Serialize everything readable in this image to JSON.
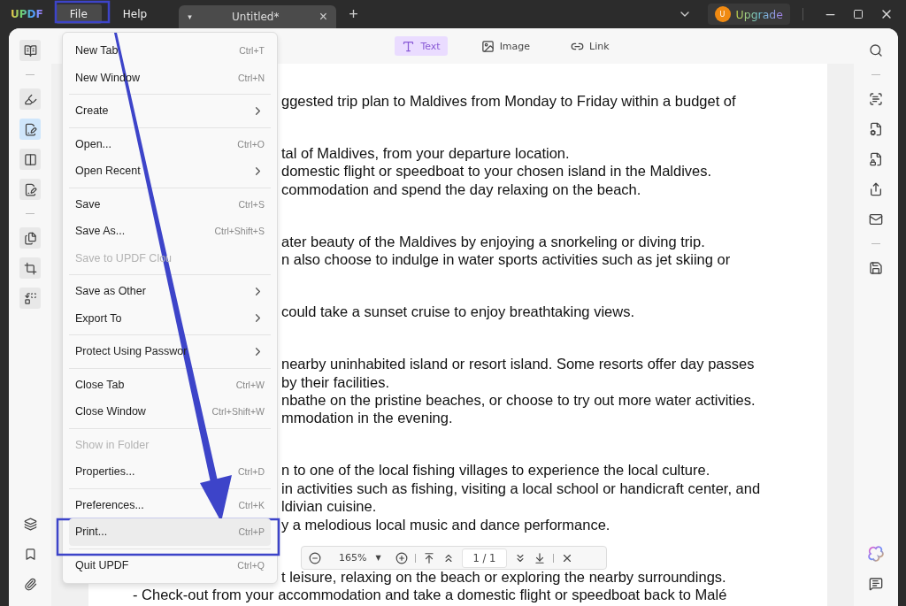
{
  "title_bar": {
    "logo": "UPDF",
    "menus": [
      {
        "label": "File",
        "selected": true
      },
      {
        "label": "Help",
        "selected": false
      }
    ],
    "tab": {
      "caret": "▾",
      "title": "Untitled*",
      "close": "×"
    },
    "new_tab": "+",
    "upgrade": {
      "avatar_initial": "U",
      "label": "Upgrade"
    }
  },
  "left_rail": [
    {
      "kind": "reader",
      "selected": false
    },
    {
      "kind": "divider"
    },
    {
      "kind": "comment",
      "selected": false
    },
    {
      "kind": "edit",
      "selected": true
    },
    {
      "kind": "organize",
      "selected": false
    },
    {
      "kind": "fill-sign",
      "selected": false
    },
    {
      "kind": "divider"
    },
    {
      "kind": "pages",
      "selected": false
    },
    {
      "kind": "crop",
      "selected": false
    },
    {
      "kind": "replace",
      "selected": false
    }
  ],
  "left_rail_bottom": [
    {
      "kind": "layers"
    },
    {
      "kind": "bookmark"
    },
    {
      "kind": "attachment"
    }
  ],
  "edit_toolbar": [
    {
      "kind": "text",
      "label": "Text",
      "selected": true
    },
    {
      "kind": "image",
      "label": "Image",
      "selected": false
    },
    {
      "kind": "link",
      "label": "Link",
      "selected": false
    }
  ],
  "document": {
    "paragraphs": [
      {
        "lines": [
          "ggested trip plan to Maldives from Monday to Friday within a budget of"
        ]
      },
      {
        "lines": [
          "tal of Maldives, from your departure location.",
          "domestic flight or speedboat to your chosen island in the Maldives.",
          "commodation and spend the day relaxing on the beach."
        ]
      },
      {
        "lines": [
          "ater beauty of the Maldives by enjoying a snorkeling or diving trip.",
          "n also choose to indulge in water sports activities such as jet skiing or"
        ]
      },
      {
        "lines": [
          "could take a sunset cruise to enjoy breathtaking views."
        ]
      },
      {
        "lines": [
          "nearby uninhabited island or resort island. Some resorts offer day passes",
          "by their facilities.",
          "nbathe on the pristine beaches, or choose to try out more water activities.",
          "mmodation in the evening."
        ]
      },
      {
        "lines": [
          "n to one of the local fishing villages to experience the local culture.",
          "in activities such as fishing, visiting a local school or handicraft center, and",
          "ldivian cuisine.",
          "y a melodious local music and dance performance."
        ]
      },
      {
        "lines": [
          "t leisure, relaxing on the beach or exploring the nearby surroundings."
        ]
      }
    ],
    "bottom_line": "- Check-out from your accommodation and take a domestic flight or speedboat back to Malé"
  },
  "right_rail": [
    {
      "kind": "search"
    },
    {
      "kind": "divider"
    },
    {
      "kind": "ocr"
    },
    {
      "kind": "convert"
    },
    {
      "kind": "protect"
    },
    {
      "kind": "share"
    },
    {
      "kind": "mail"
    },
    {
      "kind": "divider"
    },
    {
      "kind": "save"
    }
  ],
  "right_rail_bottom": [
    {
      "kind": "ai"
    },
    {
      "kind": "comments"
    }
  ],
  "file_menu": {
    "groups": [
      [
        {
          "label": "New Tab",
          "shortcut": "Ctrl+T",
          "kind": "item",
          "disabled": false,
          "selected": false
        },
        {
          "label": "New Window",
          "shortcut": "Ctrl+N",
          "kind": "item",
          "disabled": false,
          "selected": false
        }
      ],
      [
        {
          "label": "Create",
          "kind": "submenu",
          "disabled": false,
          "selected": false
        }
      ],
      [
        {
          "label": "Open...",
          "shortcut": "Ctrl+O",
          "kind": "item",
          "disabled": false,
          "selected": false
        },
        {
          "label": "Open Recent",
          "kind": "submenu",
          "disabled": false,
          "selected": false
        }
      ],
      [
        {
          "label": "Save",
          "shortcut": "Ctrl+S",
          "kind": "item",
          "disabled": false,
          "selected": false
        },
        {
          "label": "Save As...",
          "shortcut": "Ctrl+Shift+S",
          "kind": "item",
          "disabled": false,
          "selected": false
        },
        {
          "label": "Save to UPDF Clou",
          "kind": "item",
          "disabled": true,
          "selected": false
        }
      ],
      [
        {
          "label": "Save as Other",
          "kind": "submenu",
          "disabled": false,
          "selected": false
        },
        {
          "label": "Export To",
          "kind": "submenu",
          "disabled": false,
          "selected": false
        }
      ],
      [
        {
          "label": "Protect Using Passwor",
          "kind": "submenu",
          "disabled": false,
          "selected": false
        }
      ],
      [
        {
          "label": "Close Tab",
          "shortcut": "Ctrl+W",
          "kind": "item",
          "disabled": false,
          "selected": false
        },
        {
          "label": "Close Window",
          "shortcut": "Ctrl+Shift+W",
          "kind": "item",
          "disabled": false,
          "selected": false
        }
      ],
      [
        {
          "label": "Show in Folder",
          "kind": "item",
          "disabled": true,
          "selected": false
        },
        {
          "label": "Properties...",
          "shortcut": "Ctrl+D",
          "kind": "item",
          "disabled": false,
          "selected": false
        }
      ],
      [
        {
          "label": "Preferences...",
          "shortcut": "Ctrl+K",
          "kind": "item",
          "disabled": false,
          "selected": false
        },
        {
          "label": "Print...",
          "shortcut": "Ctrl+P",
          "kind": "item",
          "disabled": false,
          "selected": true
        }
      ],
      [
        {
          "label": "Quit UPDF",
          "shortcut": "Ctrl+Q",
          "kind": "item",
          "disabled": false,
          "selected": false
        }
      ]
    ]
  },
  "zoom_bar": {
    "zoom": "165%",
    "caret": "▼",
    "page": "1 / 1"
  }
}
